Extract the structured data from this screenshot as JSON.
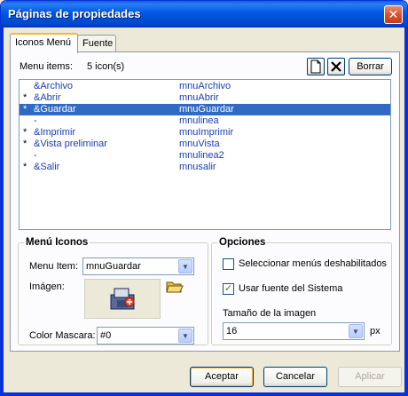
{
  "window": {
    "title": "Páginas de propiedades",
    "close_glyph": "✕"
  },
  "tabs": [
    {
      "label": "Iconos Menú",
      "active": true
    },
    {
      "label": "Fuente",
      "active": false
    }
  ],
  "menu_items": {
    "label": "Menu items:",
    "count": "5 icon(s)",
    "new_icon": "new-document-icon",
    "delete_icon": "delete-x-icon",
    "clear_button": "Borrar",
    "rows": [
      {
        "star": "",
        "caption": "&Archivo",
        "name": "mnuArchivo",
        "selected": false
      },
      {
        "star": "*",
        "caption": "&Abrir",
        "name": "mnuAbrir",
        "selected": false
      },
      {
        "star": "*",
        "caption": "&Guardar",
        "name": "mnuGuardar",
        "selected": true
      },
      {
        "star": "",
        "caption": "-",
        "name": "mnulinea",
        "selected": false
      },
      {
        "star": "*",
        "caption": "&Imprimir",
        "name": "mnuImprimir",
        "selected": false
      },
      {
        "star": "*",
        "caption": "&Vista preliminar",
        "name": "mnuVista",
        "selected": false
      },
      {
        "star": "",
        "caption": "-",
        "name": "mnulinea2",
        "selected": false
      },
      {
        "star": "*",
        "caption": "&Salir",
        "name": "mnusalir",
        "selected": false
      }
    ]
  },
  "menu_icons_group": {
    "title": "Menú Iconos",
    "menu_item_label": "Menu Item:",
    "menu_item_value": "mnuGuardar",
    "image_label": "Imágen:",
    "open_icon": "folder-open-icon",
    "preview_icon": "save-disk-icon",
    "mask_label": "Color Mascara:",
    "mask_value": "#0"
  },
  "options_group": {
    "title": "Opciones",
    "disabled_menus_label": "Seleccionar menús deshabilitados",
    "disabled_menus_checked": false,
    "system_font_label": "Usar fuente del Sistema",
    "system_font_checked": true,
    "image_size_label": "Tamaño de la imagen",
    "image_size_value": "16",
    "unit": "px"
  },
  "footer": {
    "accept": "Aceptar",
    "cancel": "Cancelar",
    "apply": "Aplicar"
  },
  "colors": {
    "selection": "#316ac5",
    "titlebar": "#0057e0",
    "item_text": "#1c3eae"
  }
}
